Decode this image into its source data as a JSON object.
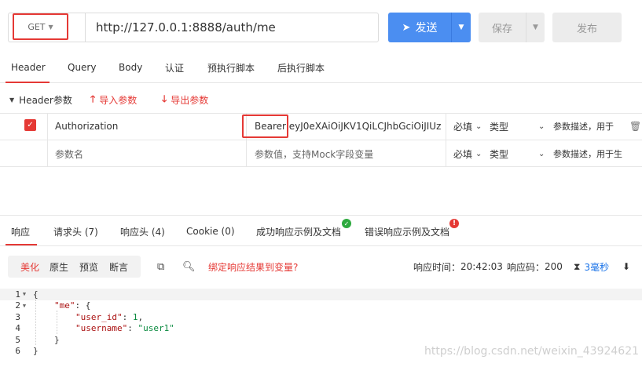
{
  "request": {
    "method": "GET",
    "url": "http://127.0.0.1:8888/auth/me",
    "send_label": "发送",
    "save_label": "保存",
    "publish_label": "发布"
  },
  "request_tabs": [
    "Header",
    "Query",
    "Body",
    "认证",
    "预执行脚本",
    "后执行脚本"
  ],
  "header_section": {
    "title": "Header参数",
    "import_label": "导入参数",
    "export_label": "导出参数"
  },
  "header_rows": [
    {
      "key": "Authorization",
      "value": "Bearer eyJ0eXAiOiJKV1QiLCJhbGciOiJIUz",
      "required": "必填",
      "type": "类型",
      "desc": "参数描述，用于"
    },
    {
      "key": "参数名",
      "value": "参数值，支持Mock字段变量",
      "required": "必填",
      "type": "类型",
      "desc": "参数描述，用于生"
    }
  ],
  "response_tabs": [
    "响应",
    "请求头 (7)",
    "响应头 (4)",
    "Cookie (0)",
    "成功响应示例及文档",
    "错误响应示例及文档"
  ],
  "view_modes": [
    "美化",
    "原生",
    "预览",
    "断言"
  ],
  "bind_label": "绑定响应结果到变量?",
  "response_meta": {
    "time_label": "响应时间：",
    "time_value": "20:42:03",
    "code_label": "响应码：",
    "code_value": "200",
    "duration": "3毫秒"
  },
  "code_lines": [
    {
      "n": "1",
      "fold": true,
      "text": "{"
    },
    {
      "n": "2",
      "fold": true,
      "text": "\"me\": {"
    },
    {
      "n": "3",
      "fold": false,
      "text": "\"user_id\": 1,"
    },
    {
      "n": "4",
      "fold": false,
      "text": "\"username\": \"user1\""
    },
    {
      "n": "5",
      "fold": false,
      "text": "}"
    },
    {
      "n": "6",
      "fold": false,
      "text": "}"
    }
  ],
  "watermark": "https://blog.csdn.net/weixin_43924621",
  "colors": {
    "accent_red": "#e53935",
    "send_blue": "#4b8ef1",
    "success_green": "#2eaa3f"
  }
}
